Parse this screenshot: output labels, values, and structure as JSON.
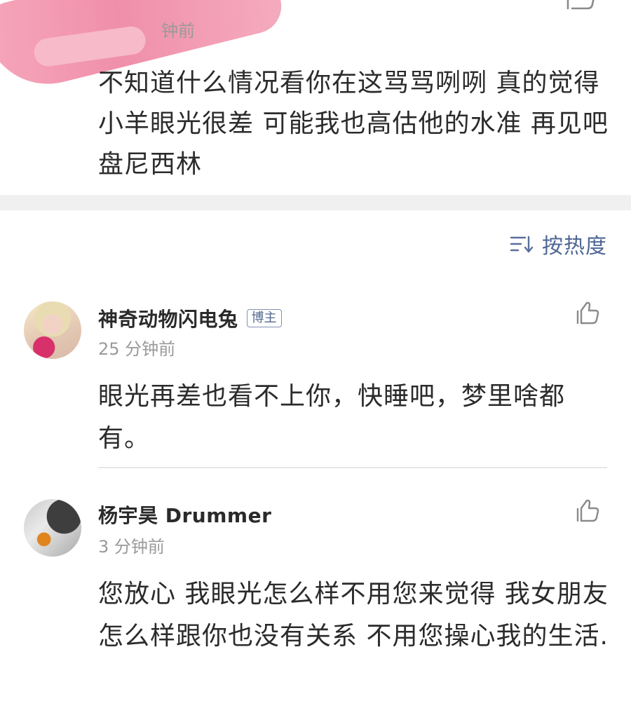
{
  "top_comment": {
    "time": "钟前",
    "text": "不知道什么情况看你在这骂骂咧咧 真的觉得小羊眼光很差 可能我也高估他的水准 再见吧盘尼西林"
  },
  "sort": {
    "label": "按热度",
    "icon": "sort-icon"
  },
  "comments": [
    {
      "user": "神奇动物闪电兔",
      "badge": "博主",
      "time": "25 分钟前",
      "text": "眼光再差也看不上你，快睡吧，梦里啥都有。",
      "like_icon": "thumbs-up-icon"
    },
    {
      "user": "杨宇昊 Drummer",
      "time": "3 分钟前",
      "text": "您放心 我眼光怎么样不用您来觉得 我女朋友怎么样跟你也没有关系 不用您操心我的生活.",
      "like_icon": "thumbs-up-icon"
    }
  ],
  "colors": {
    "link_blue": "#4f6795",
    "text": "#2b2b2b",
    "muted": "#9a9a9a",
    "band": "#f0f0f0",
    "redaction_pink": "#f08aa6"
  }
}
